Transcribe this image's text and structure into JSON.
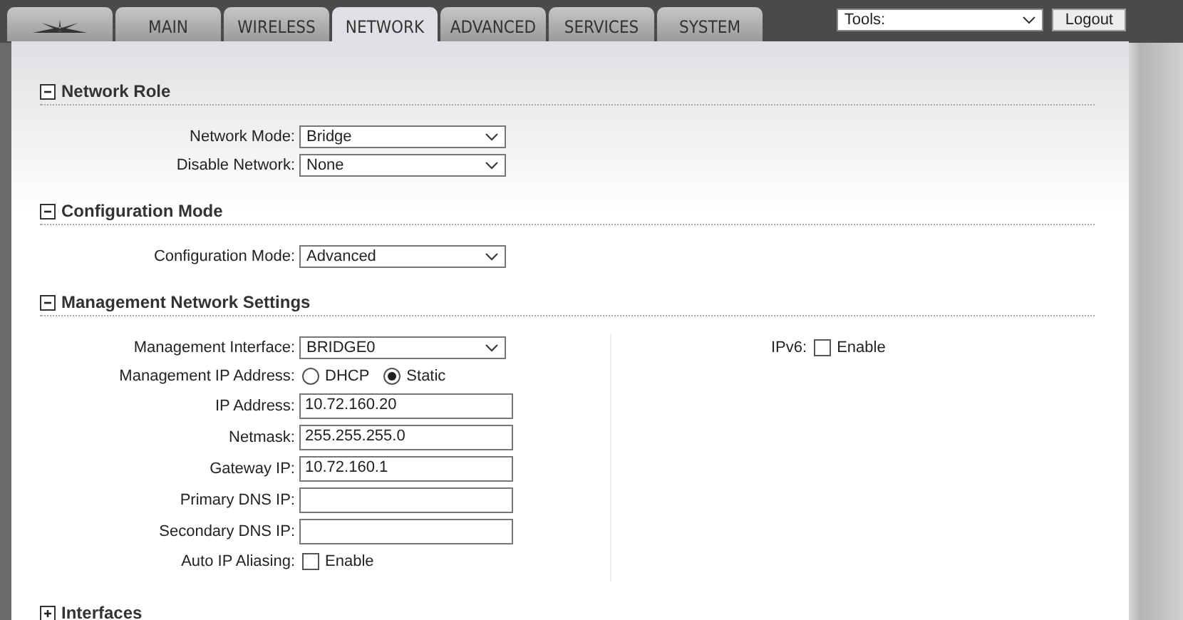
{
  "tabs": [
    {
      "kind": "logo",
      "selected": false
    },
    {
      "label": "MAIN",
      "selected": false
    },
    {
      "label": "WIRELESS",
      "selected": false
    },
    {
      "label": "NETWORK",
      "selected": true
    },
    {
      "label": "ADVANCED",
      "selected": false
    },
    {
      "label": "SERVICES",
      "selected": false
    },
    {
      "label": "SYSTEM",
      "selected": false
    }
  ],
  "tools": {
    "value": "Tools:"
  },
  "logout": "Logout",
  "sections": [
    {
      "title": "Network Role",
      "expanded": true,
      "rows": [
        {
          "kind": "select",
          "label": "Network Mode:",
          "value": "Bridge"
        },
        {
          "kind": "select",
          "label": "Disable Network:",
          "value": "None"
        }
      ]
    },
    {
      "title": "Configuration Mode",
      "expanded": true,
      "rows": [
        {
          "kind": "select",
          "label": "Configuration Mode:",
          "value": "Advanced"
        }
      ]
    },
    {
      "title": "Management Network Settings",
      "expanded": true,
      "rows": [
        {
          "kind": "select",
          "label": "Management Interface:",
          "value": "BRIDGE0"
        },
        {
          "kind": "radio",
          "label": "Management IP Address:",
          "options": [
            {
              "label": "DHCP",
              "selected": false
            },
            {
              "label": "Static",
              "selected": true
            }
          ]
        },
        {
          "kind": "text",
          "label": "IP Address:",
          "value": "10.72.160.20"
        },
        {
          "kind": "text",
          "label": "Netmask:",
          "value": "255.255.255.0"
        },
        {
          "kind": "text",
          "label": "Gateway IP:",
          "value": "10.72.160.1"
        },
        {
          "kind": "text",
          "label": "Primary DNS IP:"
        },
        {
          "kind": "text",
          "label": "Secondary DNS IP:"
        },
        {
          "kind": "checkbox",
          "label": "Auto IP Aliasing:",
          "option": "Enable",
          "checked": false
        }
      ],
      "side": [
        {
          "kind": "checkbox",
          "label": "IPv6:",
          "option": "Enable",
          "checked": false
        }
      ]
    },
    {
      "title": "Interfaces",
      "expanded": false
    }
  ]
}
